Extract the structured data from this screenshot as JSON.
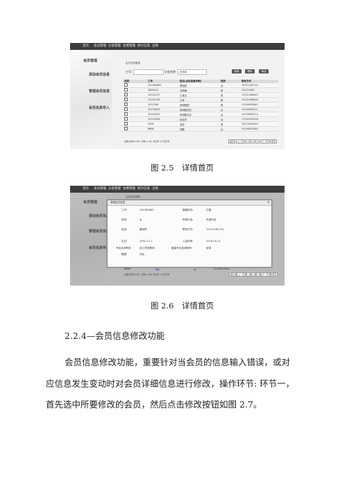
{
  "nav": [
    "首页",
    "会员管理",
    "分会管理",
    "会费管理",
    "统计信息",
    "注销"
  ],
  "side": [
    "会员管理",
    "添加会员信息",
    "管理会员信息",
    "会员信息导入"
  ],
  "breadcrumb": "会员信息管理",
  "search": {
    "id_label": "工号:",
    "branch_label": "分会名称:",
    "branch_value": "请选择",
    "buttons": [
      "检索",
      "删除",
      "添加"
    ]
  },
  "table": {
    "headers": [
      "选项",
      "工号",
      "姓名(点击查看详细)",
      "性别",
      "联系方式"
    ],
    "rows": [
      [
        "101564663",
        "董冠男",
        "女",
        "15151262134"
      ],
      [
        "7864212",
        "刘炳楠",
        "男",
        "13152566?"
      ],
      [
        "10101237",
        "王宝玉",
        "男",
        "13151466645"
      ],
      [
        "10101235",
        "王贺",
        "男",
        "13151466946"
      ],
      [
        "1011546",
        "张明翔园",
        "男",
        "13146555644"
      ],
      [
        "10134653",
        "张明翔测试",
        "女",
        "15146563521"
      ],
      [
        "10140453",
        "张明翔对比",
        "女",
        "15146565414"
      ],
      [
        "10153264",
        "张佳杰",
        "女",
        "17352255156"
      ],
      [
        "9999",
        "测试",
        "男",
        "15125644563"
      ],
      [
        "8888",
        "测额",
        "女",
        "15146523464"
      ]
    ],
    "pager_info": "总数记录共10条 | 页数 10 条, 总共有 14 页记录",
    "pager": [
      "首页",
      "上一页",
      "1",
      "2",
      "3",
      "下一页",
      "尾页"
    ]
  },
  "captions": [
    "图 2.5　详情首页",
    "图 2.6　详情首页"
  ],
  "modal": {
    "title": "查看会员信息",
    "rows": [
      [
        "工号:",
        "101564663",
        "婚姻状况:",
        "已婚"
      ],
      [
        "性别:",
        "女",
        "所属分会:",
        "天津分会"
      ],
      [
        "姓名:",
        "董冠男",
        "联系方式:",
        "15151262134"
      ],
      [
        "生日:",
        "1992-11-7",
        "入会时间:",
        "2018-04-11"
      ],
      [
        "专业技术职务:",
        "技工学校教师",
        "最高专业技术职称:",
        "讲师"
      ],
      [
        "籍贯:",
        "河北",
        "",
        ""
      ]
    ],
    "partial_row": [
      "8888",
      "测额",
      "女",
      "15146523464"
    ]
  },
  "section_heading": "2.2.4—会员信息修改功能",
  "paragraph": [
    "会员信息修改功能，重要针对当会员的信息输入错误，或对",
    "应信息发生变动时对会员详细信息进行修改，操作环节: 环节一，",
    "首先选中所要修改的会员，然后点击修改按钮如图 2.7。"
  ]
}
